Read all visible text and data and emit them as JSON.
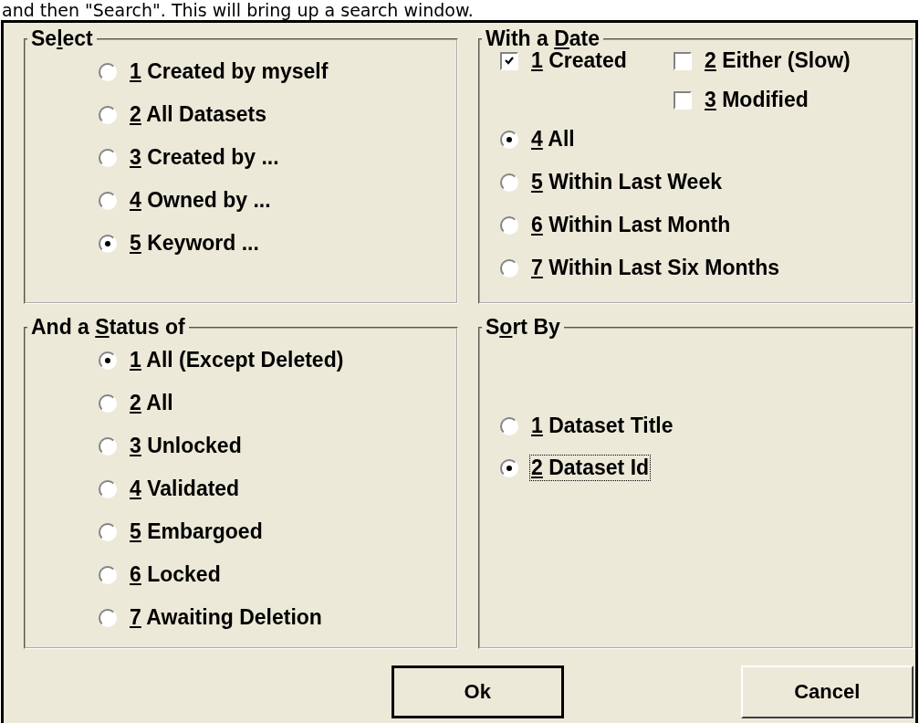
{
  "caption": "and then \"Search\". This will bring up a search window.",
  "select": {
    "title": {
      "before": "Se",
      "key": "l",
      "after": "ect"
    },
    "radios": [
      {
        "key": "1",
        "text": "Created by myself",
        "selected": false
      },
      {
        "key": "2",
        "text": "All Datasets",
        "selected": false
      },
      {
        "key": "3",
        "text": "Created by ...",
        "selected": false
      },
      {
        "key": "4",
        "text": "Owned by ...",
        "selected": false
      },
      {
        "key": "5",
        "text": "Keyword ...",
        "selected": true
      }
    ]
  },
  "with_a_date": {
    "title": {
      "before": "With a ",
      "key": "D",
      "after": "ate"
    },
    "checkboxes": [
      {
        "key": "1",
        "text": "Created",
        "checked": true
      },
      {
        "key": "2",
        "text": "Either (Slow)",
        "checked": false
      },
      {
        "key": "3",
        "text": "Modified",
        "checked": false
      }
    ],
    "radios": [
      {
        "key": "4",
        "text": "All",
        "selected": true
      },
      {
        "key": "5",
        "text": "Within Last Week",
        "selected": false
      },
      {
        "key": "6",
        "text": "Within Last Month",
        "selected": false
      },
      {
        "key": "7",
        "text": "Within Last Six Months",
        "selected": false
      }
    ]
  },
  "status": {
    "title": {
      "before": "And a ",
      "key": "S",
      "after": "tatus of"
    },
    "radios": [
      {
        "key": "1",
        "text": "All (Except Deleted)",
        "selected": true
      },
      {
        "key": "2",
        "text": "All",
        "selected": false
      },
      {
        "key": "3",
        "text": "Unlocked",
        "selected": false
      },
      {
        "key": "4",
        "text": "Validated",
        "selected": false
      },
      {
        "key": "5",
        "text": "Embargoed",
        "selected": false
      },
      {
        "key": "6",
        "text": "Locked",
        "selected": false
      },
      {
        "key": "7",
        "text": "Awaiting Deletion",
        "selected": false
      }
    ]
  },
  "sort_by": {
    "title": {
      "before": "S",
      "key": "o",
      "after": "rt By"
    },
    "radios": [
      {
        "key": "1",
        "text": "Dataset Title",
        "selected": false,
        "focused": false
      },
      {
        "key": "2",
        "text": "Dataset Id",
        "selected": true,
        "focused": true
      }
    ]
  },
  "buttons": [
    {
      "label": "Ok",
      "default": true
    },
    {
      "label": "Cancel",
      "default": false
    }
  ]
}
